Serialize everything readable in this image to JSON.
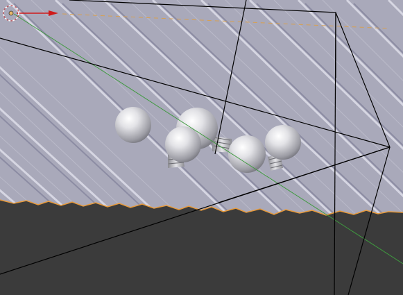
{
  "viewport": {
    "type": "blender-3d-viewport",
    "colors": {
      "background": "#3b3b3b",
      "surface": "#a7a7b8",
      "surface_ridge_light": "#dcdce8",
      "surface_ridge_dark": "#7e7e92",
      "camera_frame": "#000000",
      "selection_outline": "#f0a030",
      "axis_x": "#d01a1a",
      "axis_y": "#3f9a3f"
    },
    "objects": [
      {
        "name": "ground-plane",
        "kind": "displaced-plane",
        "selected": true
      },
      {
        "name": "light-bulb-group",
        "kind": "mesh",
        "count": 5
      },
      {
        "name": "camera",
        "kind": "camera-frustum"
      },
      {
        "name": "3d-cursor",
        "kind": "cursor-icon"
      },
      {
        "name": "object-origin",
        "kind": "origin-dot"
      }
    ],
    "axes": {
      "x_visible": true,
      "y_visible": true
    }
  }
}
